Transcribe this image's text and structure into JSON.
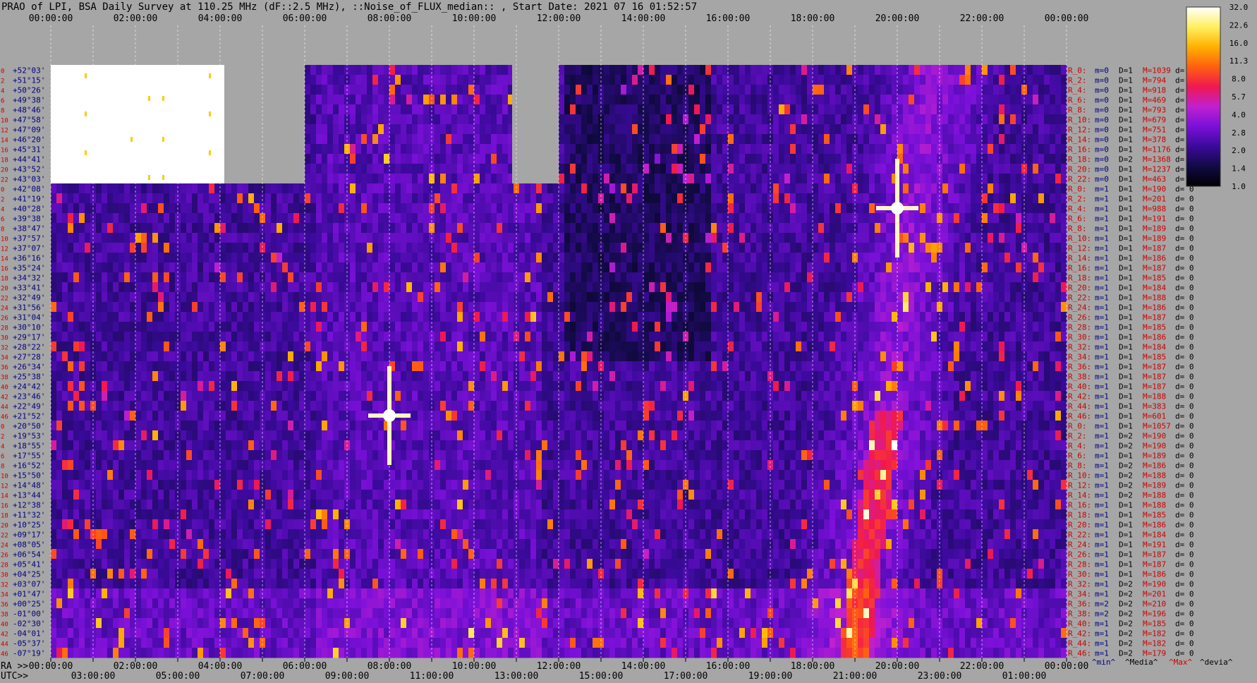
{
  "chart_data": {
    "type": "heatmap",
    "title": "PRAO of LPI, BSA Daily Survey at 110.25 MHz (dF::2.5 MHz), ::Noise_of_FLUX_median:: , Start Date: 2021 07 16 01:52:57",
    "top_axis_ticks": [
      "00:00:00",
      "02:00:00",
      "04:00:00",
      "06:00:00",
      "08:00:00",
      "10:00:00",
      "12:00:00",
      "14:00:00",
      "16:00:00",
      "18:00:00",
      "20:00:00",
      "22:00:00",
      "00:00:00"
    ],
    "bottom_ra_prefix": "RA >>",
    "bottom_ra_ticks": [
      "00:00:00",
      "02:00:00",
      "04:00:00",
      "06:00:00",
      "08:00:00",
      "10:00:00",
      "12:00:00",
      "14:00:00",
      "16:00:00",
      "18:00:00",
      "20:00:00",
      "22:00:00",
      "00:00:00"
    ],
    "bottom_utc_prefix": "UTC>>",
    "bottom_utc_ticks": [
      "03:00:00",
      "05:00:00",
      "07:00:00",
      "09:00:00",
      "11:00:00",
      "13:00:00",
      "15:00:00",
      "17:00:00",
      "19:00:00",
      "21:00:00",
      "23:00:00",
      "01:00:00"
    ],
    "declinations": [
      "+52°03'",
      "+51°15'",
      "+50°26'",
      "+49°38'",
      "+48°46'",
      "+47°58'",
      "+47°09'",
      "+46°20'",
      "+45°31'",
      "+44°41'",
      "+43°52'",
      "+43°03'",
      "+42°08'",
      "+41°19'",
      "+40°28'",
      "+39°38'",
      "+38°47'",
      "+37°57'",
      "+37°07'",
      "+36°16'",
      "+35°24'",
      "+34°32'",
      "+33°41'",
      "+32°49'",
      "+31°56'",
      "+31°04'",
      "+30°10'",
      "+29°17'",
      "+28°22'",
      "+27°28'",
      "+26°34'",
      "+25°38'",
      "+24°42'",
      "+23°46'",
      "+22°49'",
      "+21°52'",
      "+20°50'",
      "+19°53'",
      "+18°55'",
      "+17°55'",
      "+16°52'",
      "+15°50'",
      "+14°48'",
      "+13°44'",
      "+12°38'",
      "+11°32'",
      "+10°25'",
      "+09°17'",
      "+08°05'",
      "+06°54'",
      "+05°41'",
      "+04°25'",
      "+03°07'",
      "+01°47'",
      "+00°25'",
      "-01°00'",
      "-02°30'",
      "-04°01'",
      "-05°37'",
      "-07°19'"
    ],
    "row_index_labels": [
      "0",
      "2",
      "4",
      "6",
      "8",
      "10",
      "12",
      "14",
      "16",
      "18",
      "20",
      "22",
      "0",
      "2",
      "4",
      "6",
      "8",
      "10",
      "12",
      "14",
      "16",
      "18",
      "20",
      "22",
      "24",
      "26",
      "28",
      "30",
      "32",
      "34",
      "36",
      "38",
      "40",
      "42",
      "44",
      "46",
      "0",
      "2",
      "4",
      "6",
      "8",
      "10",
      "12",
      "14",
      "16",
      "18",
      "20",
      "22",
      "24",
      "26",
      "28",
      "30",
      "32",
      "34",
      "36",
      "38",
      "40",
      "42",
      "44",
      "46"
    ],
    "row_stats": [
      {
        "r": "R_0:",
        "m": "m=0",
        "d": "D=1",
        "mx": "M=1039",
        "dv": "d="
      },
      {
        "r": "R_2:",
        "m": "m=0",
        "d": "D=1",
        "mx": "M=794",
        "dv": "d= 0"
      },
      {
        "r": "R_4:",
        "m": "m=0",
        "d": "D=1",
        "mx": "M=918",
        "dv": "d= 0"
      },
      {
        "r": "R_6:",
        "m": "m=0",
        "d": "D=1",
        "mx": "M=469",
        "dv": "d= 0"
      },
      {
        "r": "R_8:",
        "m": "m=0",
        "d": "D=1",
        "mx": "M=793",
        "dv": "d= 0"
      },
      {
        "r": "R_10:",
        "m": "m=0",
        "d": "D=1",
        "mx": "M=679",
        "dv": "d= 0"
      },
      {
        "r": "R_12:",
        "m": "m=0",
        "d": "D=1",
        "mx": "M=751",
        "dv": "d="
      },
      {
        "r": "R_14:",
        "m": "m=0",
        "d": "D=1",
        "mx": "M=378",
        "dv": "d="
      },
      {
        "r": "R_16:",
        "m": "m=0",
        "d": "D=1",
        "mx": "M=1176",
        "dv": "d="
      },
      {
        "r": "R_18:",
        "m": "m=0",
        "d": "D=2",
        "mx": "M=1368",
        "dv": "d="
      },
      {
        "r": "R_20:",
        "m": "m=0",
        "d": "D=1",
        "mx": "M=1237",
        "dv": "d="
      },
      {
        "r": "R_22:",
        "m": "m=0",
        "d": "D=1",
        "mx": "M=463",
        "dv": "d="
      },
      {
        "r": "R_0:",
        "m": "m=1",
        "d": "D=1",
        "mx": "M=190",
        "dv": "d= 0"
      },
      {
        "r": "R_2:",
        "m": "m=1",
        "d": "D=1",
        "mx": "M=201",
        "dv": "d= 0"
      },
      {
        "r": "R_4:",
        "m": "m=1",
        "d": "D=1",
        "mx": "M=988",
        "dv": "d= 0"
      },
      {
        "r": "R_6:",
        "m": "m=1",
        "d": "D=1",
        "mx": "M=191",
        "dv": "d= 0"
      },
      {
        "r": "R_8:",
        "m": "m=1",
        "d": "D=1",
        "mx": "M=189",
        "dv": "d= 0"
      },
      {
        "r": "R_10:",
        "m": "m=1",
        "d": "D=1",
        "mx": "M=189",
        "dv": "d= 0"
      },
      {
        "r": "R_12:",
        "m": "m=1",
        "d": "D=1",
        "mx": "M=187",
        "dv": "d= 0"
      },
      {
        "r": "R_14:",
        "m": "m=1",
        "d": "D=1",
        "mx": "M=186",
        "dv": "d= 0"
      },
      {
        "r": "R_16:",
        "m": "m=1",
        "d": "D=1",
        "mx": "M=187",
        "dv": "d= 0"
      },
      {
        "r": "R_18:",
        "m": "m=1",
        "d": "D=1",
        "mx": "M=185",
        "dv": "d= 0"
      },
      {
        "r": "R_20:",
        "m": "m=1",
        "d": "D=1",
        "mx": "M=184",
        "dv": "d= 0"
      },
      {
        "r": "R_22:",
        "m": "m=1",
        "d": "D=1",
        "mx": "M=188",
        "dv": "d= 0"
      },
      {
        "r": "R_24:",
        "m": "m=1",
        "d": "D=1",
        "mx": "M=186",
        "dv": "d= 0"
      },
      {
        "r": "R_26:",
        "m": "m=1",
        "d": "D=1",
        "mx": "M=187",
        "dv": "d= 0"
      },
      {
        "r": "R_28:",
        "m": "m=1",
        "d": "D=1",
        "mx": "M=185",
        "dv": "d= 0"
      },
      {
        "r": "R_30:",
        "m": "m=1",
        "d": "D=1",
        "mx": "M=186",
        "dv": "d= 0"
      },
      {
        "r": "R_32:",
        "m": "m=1",
        "d": "D=1",
        "mx": "M=184",
        "dv": "d= 0"
      },
      {
        "r": "R_34:",
        "m": "m=1",
        "d": "D=1",
        "mx": "M=185",
        "dv": "d= 0"
      },
      {
        "r": "R_36:",
        "m": "m=1",
        "d": "D=1",
        "mx": "M=187",
        "dv": "d= 0"
      },
      {
        "r": "R_38:",
        "m": "m=1",
        "d": "D=1",
        "mx": "M=187",
        "dv": "d= 0"
      },
      {
        "r": "R_40:",
        "m": "m=1",
        "d": "D=1",
        "mx": "M=187",
        "dv": "d= 0"
      },
      {
        "r": "R_42:",
        "m": "m=1",
        "d": "D=1",
        "mx": "M=188",
        "dv": "d= 0"
      },
      {
        "r": "R_44:",
        "m": "m=1",
        "d": "D=1",
        "mx": "M=383",
        "dv": "d= 0"
      },
      {
        "r": "R_46:",
        "m": "m=1",
        "d": "D=1",
        "mx": "M=601",
        "dv": "d= 0"
      },
      {
        "r": "R_0:",
        "m": "m=1",
        "d": "D=1",
        "mx": "M=1057",
        "dv": "d= 0"
      },
      {
        "r": "R_2:",
        "m": "m=1",
        "d": "D=2",
        "mx": "M=190",
        "dv": "d= 0"
      },
      {
        "r": "R_4:",
        "m": "m=1",
        "d": "D=2",
        "mx": "M=190",
        "dv": "d= 0"
      },
      {
        "r": "R_6:",
        "m": "m=1",
        "d": "D=1",
        "mx": "M=189",
        "dv": "d= 0"
      },
      {
        "r": "R_8:",
        "m": "m=1",
        "d": "D=2",
        "mx": "M=186",
        "dv": "d= 0"
      },
      {
        "r": "R_10:",
        "m": "m=1",
        "d": "D=2",
        "mx": "M=188",
        "dv": "d= 0"
      },
      {
        "r": "R_12:",
        "m": "m=1",
        "d": "D=2",
        "mx": "M=189",
        "dv": "d= 0"
      },
      {
        "r": "R_14:",
        "m": "m=1",
        "d": "D=2",
        "mx": "M=188",
        "dv": "d= 0"
      },
      {
        "r": "R_16:",
        "m": "m=1",
        "d": "D=1",
        "mx": "M=188",
        "dv": "d= 0"
      },
      {
        "r": "R_18:",
        "m": "m=1",
        "d": "D=1",
        "mx": "M=185",
        "dv": "d= 0"
      },
      {
        "r": "R_20:",
        "m": "m=1",
        "d": "D=1",
        "mx": "M=186",
        "dv": "d= 0"
      },
      {
        "r": "R_22:",
        "m": "m=1",
        "d": "D=1",
        "mx": "M=184",
        "dv": "d= 0"
      },
      {
        "r": "R_24:",
        "m": "m=1",
        "d": "D=1",
        "mx": "M=191",
        "dv": "d= 0"
      },
      {
        "r": "R_26:",
        "m": "m=1",
        "d": "D=1",
        "mx": "M=187",
        "dv": "d= 0"
      },
      {
        "r": "R_28:",
        "m": "m=1",
        "d": "D=1",
        "mx": "M=187",
        "dv": "d= 0"
      },
      {
        "r": "R_30:",
        "m": "m=1",
        "d": "D=1",
        "mx": "M=186",
        "dv": "d= 0"
      },
      {
        "r": "R_32:",
        "m": "m=1",
        "d": "D=2",
        "mx": "M=190",
        "dv": "d= 0"
      },
      {
        "r": "R_34:",
        "m": "m=1",
        "d": "D=2",
        "mx": "M=201",
        "dv": "d= 0"
      },
      {
        "r": "R_36:",
        "m": "m=2",
        "d": "D=2",
        "mx": "M=210",
        "dv": "d= 0"
      },
      {
        "r": "R_38:",
        "m": "m=2",
        "d": "D=2",
        "mx": "M=196",
        "dv": "d= 0"
      },
      {
        "r": "R_40:",
        "m": "m=1",
        "d": "D=2",
        "mx": "M=185",
        "dv": "d= 0"
      },
      {
        "r": "R_42:",
        "m": "m=1",
        "d": "D=2",
        "mx": "M=182",
        "dv": "d= 0"
      },
      {
        "r": "R_44:",
        "m": "m=1",
        "d": "D=2",
        "mx": "M=182",
        "dv": "d= 0"
      },
      {
        "r": "R_46:",
        "m": "m=1",
        "d": "D=2",
        "mx": "M=179",
        "dv": "d= 0"
      }
    ],
    "stats_footer": {
      "min": "^min^",
      "median": "^Media^",
      "max": "^Max^",
      "dev": "^devia^"
    },
    "colorbar": {
      "ticks": [
        "32.0",
        "22.6",
        "16.0",
        "11.3",
        "8.0",
        "5.7",
        "4.0",
        "2.8",
        "2.0",
        "1.4",
        "1.0"
      ],
      "scale": "log",
      "range": [
        1.0,
        32.0
      ],
      "colors": [
        "#000000",
        "#120a45",
        "#3a0a9a",
        "#7a10d8",
        "#c020d0",
        "#f01850",
        "#ff6010",
        "#ffb000",
        "#fff060",
        "#ffffff"
      ]
    },
    "masked_regions": [
      {
        "from": "00:00:00",
        "to": "04:00:00",
        "dec_from": "+52°03'",
        "dec_to": "+43°03'",
        "fill": "white"
      },
      {
        "from": "04:00:00",
        "to": "06:00:00",
        "dec_from": "+52°03'",
        "dec_to": "+43°03'",
        "fill": "gray"
      },
      {
        "from": "11:00:00",
        "to": "12:00:00",
        "dec_from": "+52°03'",
        "dec_to": "+43°03'",
        "fill": "gray"
      }
    ],
    "bright_sources": [
      {
        "ra": "08:00:00",
        "dec": "+21°52'",
        "label_free": true
      },
      {
        "ra": "20:00:00",
        "dec": "+40°28'",
        "label_free": true
      }
    ]
  }
}
